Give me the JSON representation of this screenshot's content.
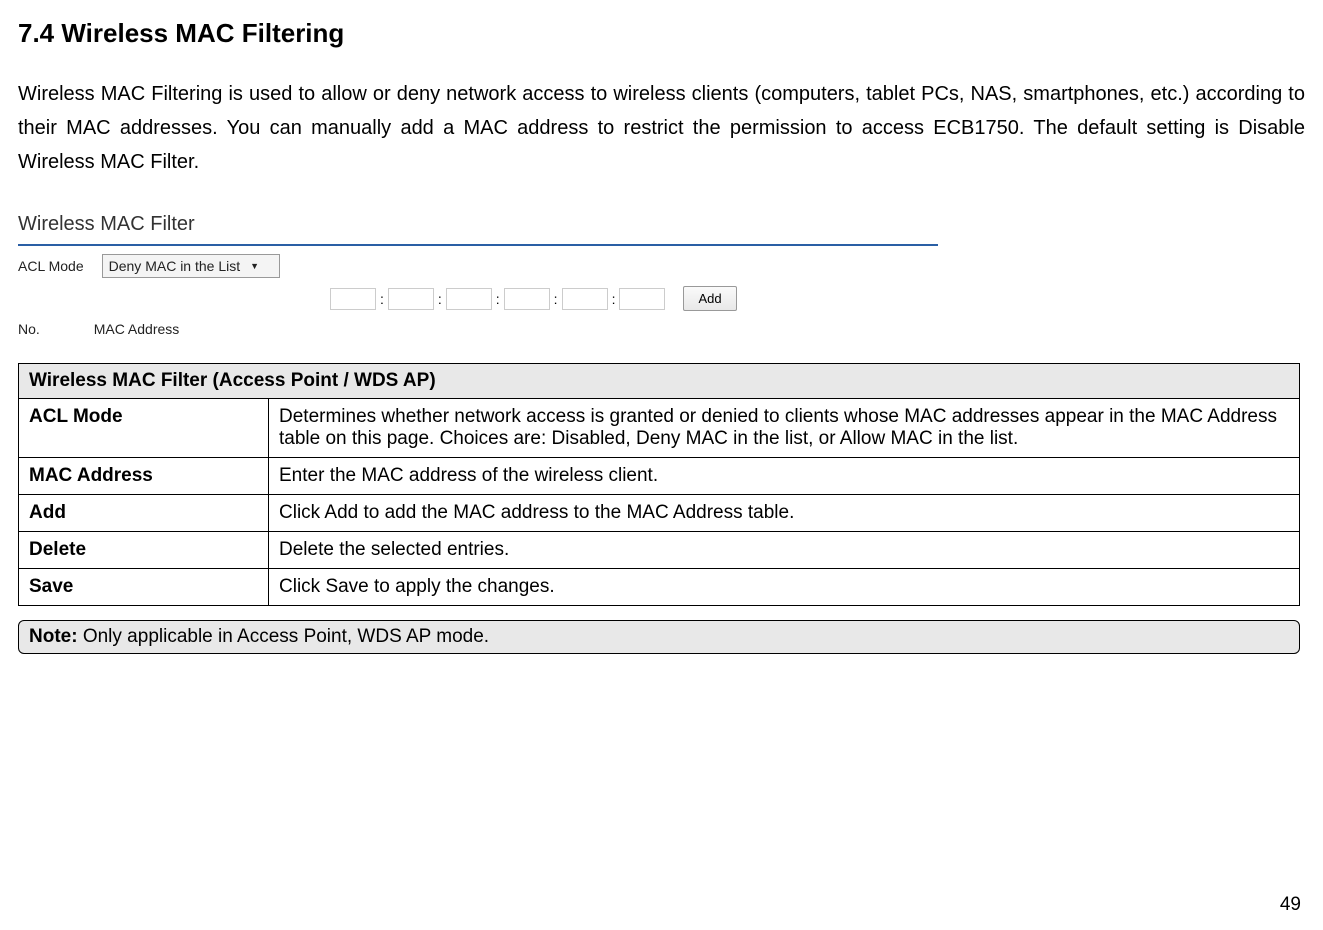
{
  "heading": "7.4   Wireless MAC Filtering",
  "intro": "Wireless MAC Filtering is used to allow or deny network access to wireless clients (computers, tablet PCs, NAS, smartphones, etc.) according to their MAC addresses. You can manually add a MAC address to restrict the permission to access ECB1750. The default setting is Disable Wireless MAC Filter.",
  "screenshot": {
    "title": "Wireless MAC Filter",
    "acl_label": "ACL Mode",
    "acl_value": "Deny MAC in the List",
    "add_label": "Add",
    "col_no": "No.",
    "col_mac": "MAC Address"
  },
  "table": {
    "header": "Wireless MAC Filter (Access Point / WDS AP)",
    "rows": [
      {
        "name": "ACL Mode",
        "desc": "Determines whether network access is granted or denied to clients whose MAC addresses appear in the MAC Address table on this page. Choices are: Disabled, Deny MAC in the list, or Allow MAC in the list."
      },
      {
        "name": "MAC Address",
        "desc": "Enter the MAC address of the wireless client."
      },
      {
        "name": "Add",
        "desc": "Click Add to add the MAC address to the MAC Address table."
      },
      {
        "name": "Delete",
        "desc": "Delete the selected entries."
      },
      {
        "name": "Save",
        "desc": "Click Save to apply the changes."
      }
    ]
  },
  "note": {
    "label": "Note:",
    "text": " Only applicable in Access Point, WDS AP mode."
  },
  "page_number": "49"
}
